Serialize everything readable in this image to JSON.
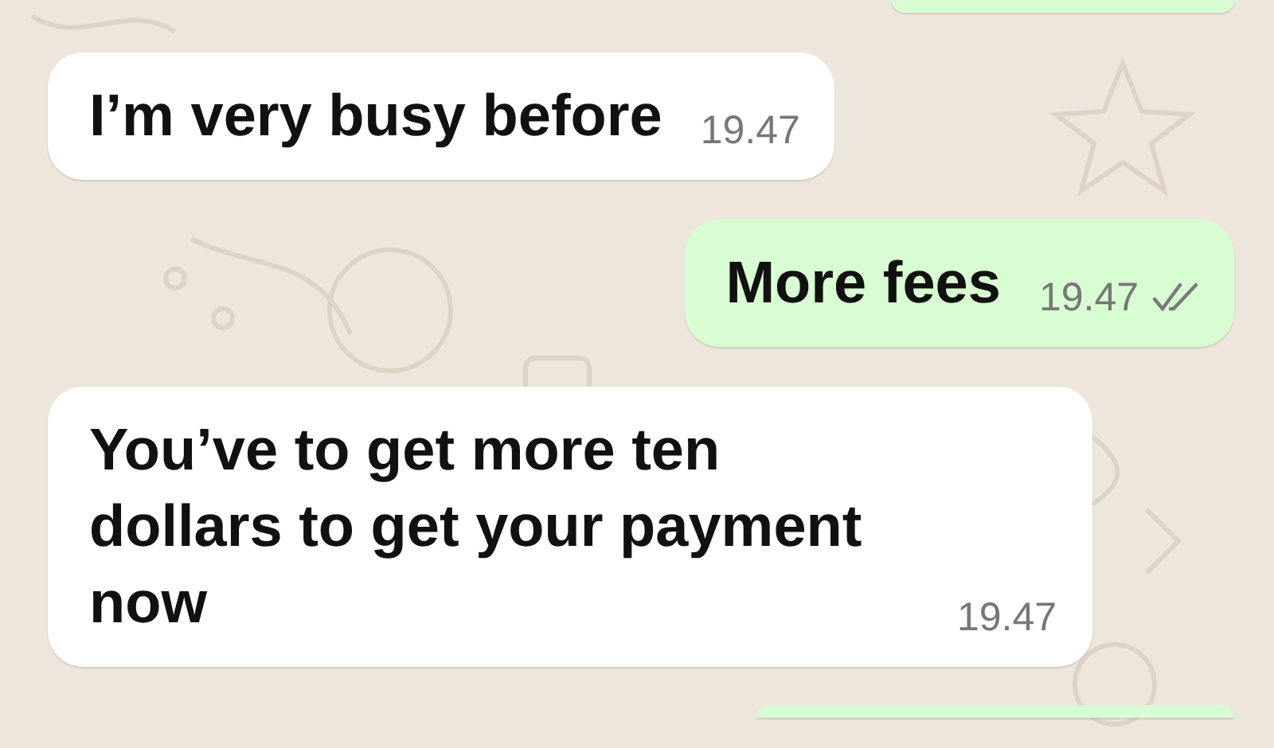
{
  "messages": [
    {
      "kind": "cut-off",
      "outgoing": true
    },
    {
      "kind": "text",
      "outgoing": false,
      "text": "I’m very busy before",
      "time": "19.47"
    },
    {
      "kind": "text",
      "outgoing": true,
      "text": "More fees",
      "time": "19.47",
      "read": false
    },
    {
      "kind": "text",
      "outgoing": false,
      "text": "You’ve to get more ten dollars to get your payment now",
      "time": "19.47"
    },
    {
      "kind": "cut-off",
      "outgoing": true
    }
  ]
}
